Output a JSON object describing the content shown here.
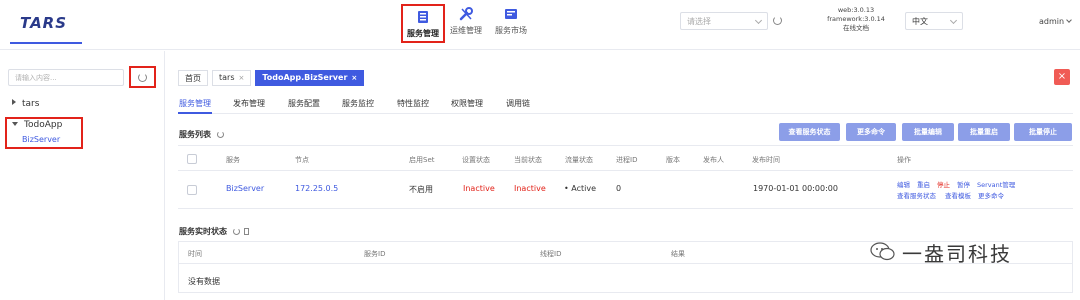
{
  "header": {
    "logo": "TARS",
    "nav": [
      {
        "label": "服务管理",
        "icon": "server-icon",
        "active": true
      },
      {
        "label": "运维管理",
        "icon": "wrench-icon",
        "active": false
      },
      {
        "label": "服务市场",
        "icon": "market-icon",
        "active": false
      }
    ],
    "select_placeholder": "请选择",
    "version": {
      "web": "web:3.0.13",
      "framework": "framework:3.0.14",
      "docs": "在线文档"
    },
    "language": "中文",
    "user": "admin"
  },
  "sidebar": {
    "search_placeholder": "请输入内容...",
    "tree": [
      {
        "label": "tars",
        "expanded": false
      },
      {
        "label": "TodoApp",
        "expanded": true,
        "children": [
          "BizServer"
        ]
      }
    ]
  },
  "breadcrumbs": [
    {
      "label": "首页"
    },
    {
      "label": "tars",
      "close": "×"
    },
    {
      "label": "TodoApp.BizServer",
      "close": "×",
      "active": true
    }
  ],
  "tabs": [
    "服务管理",
    "发布管理",
    "服务配置",
    "服务监控",
    "特性监控",
    "权限管理",
    "调用链"
  ],
  "service_list": {
    "title": "服务列表",
    "buttons": [
      "查看服务状态",
      "更多命令",
      "批量编辑",
      "批量重启",
      "批量停止"
    ],
    "columns": [
      "服务",
      "节点",
      "启用Set",
      "设置状态",
      "当前状态",
      "流量状态",
      "进程ID",
      "版本",
      "发布人",
      "发布时间",
      "操作"
    ],
    "rows": [
      {
        "service": "BizServer",
        "node": "172.25.0.5",
        "set": "不启用",
        "setting_state": "Inactive",
        "current_state": "Inactive",
        "traffic_state": "• Active",
        "pid": "0",
        "version": "",
        "publisher": "",
        "publish_time": "1970-01-01 00:00:00",
        "ops_line1": [
          "编辑",
          "重启",
          "停止",
          "暂停",
          "Servant管理"
        ],
        "ops_line2": [
          "查看服务状态",
          "查看模板",
          "更多命令"
        ]
      }
    ]
  },
  "realtime": {
    "title": "服务实时状态",
    "columns": [
      "时间",
      "服务ID",
      "线程ID",
      "结果"
    ],
    "empty": "没有数据"
  },
  "watermark": "一盎司科技",
  "colors": {
    "accent": "#3f5ae0",
    "danger": "#e2231a",
    "button": "#8c9ee8"
  }
}
